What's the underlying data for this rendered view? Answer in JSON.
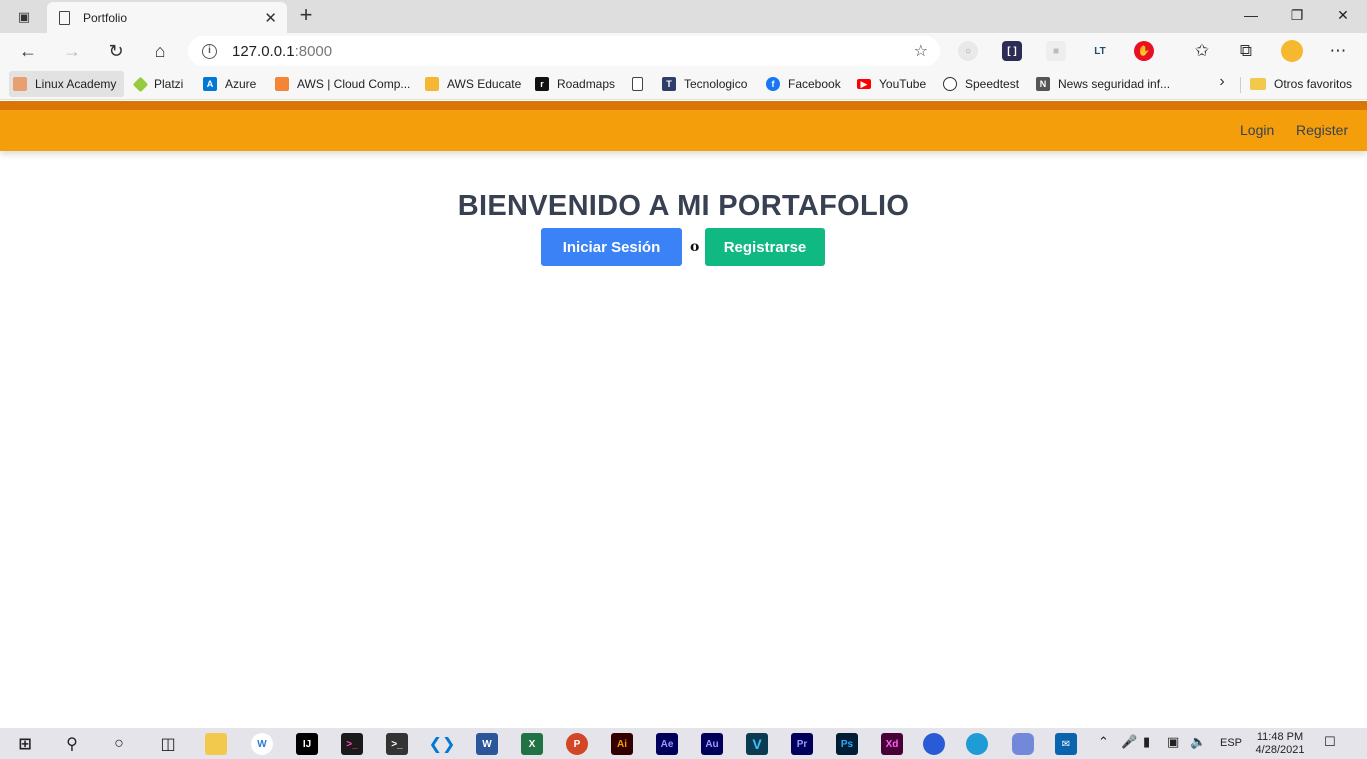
{
  "browser": {
    "tab_title": "Portfolio",
    "address_host": "127.0.0.1",
    "address_port": ":8000",
    "bookmarks": [
      {
        "label": "Linux Academy",
        "color": "#e8a070"
      },
      {
        "label": "Platzi",
        "color": "#98ca3f"
      },
      {
        "label": "Azure",
        "color": "#0078d4"
      },
      {
        "label": "AWS | Cloud Comp...",
        "color": "#f58536"
      },
      {
        "label": "AWS Educate",
        "color": "#f5b731"
      },
      {
        "label": "Roadmaps",
        "color": "#111111"
      },
      {
        "label": "",
        "color": "#ffffff"
      },
      {
        "label": "Tecnologico",
        "color": "#2f3d6b"
      },
      {
        "label": "Facebook",
        "color": "#1877f2"
      },
      {
        "label": "YouTube",
        "color": "#ff0000"
      },
      {
        "label": "Speedtest",
        "color": "#333333"
      },
      {
        "label": "News seguridad inf...",
        "color": "#555555"
      }
    ],
    "other_favorites": "Otros favoritos"
  },
  "page": {
    "nav_login": "Login",
    "nav_register": "Register",
    "heading": "BIENVENIDO A MI PORTAFOLIO",
    "login_button": "Iniciar Sesión",
    "separator": "o",
    "register_button": "Registrarse",
    "colors": {
      "navbar": "#f59e0b",
      "login_button": "#3b82f6",
      "register_button": "#10b981"
    }
  },
  "taskbar": {
    "language": "ESP",
    "time": "11:48 PM",
    "date": "4/28/2021",
    "apps": [
      {
        "name": "Word",
        "glyph": "W",
        "color": "#2b579a"
      },
      {
        "name": "Excel",
        "glyph": "X",
        "color": "#217346"
      },
      {
        "name": "PowerPoint",
        "glyph": "P",
        "color": "#d24726"
      },
      {
        "name": "Illustrator",
        "glyph": "Ai",
        "color": "#330000"
      },
      {
        "name": "After Effects",
        "glyph": "Ae",
        "color": "#00005b"
      },
      {
        "name": "Audition",
        "glyph": "Au",
        "color": "#00005b"
      },
      {
        "name": "Vegas",
        "glyph": "V",
        "color": "#0b3b50"
      },
      {
        "name": "Premiere",
        "glyph": "Pr",
        "color": "#00005b"
      },
      {
        "name": "Photoshop",
        "glyph": "Ps",
        "color": "#001e36"
      },
      {
        "name": "XD",
        "glyph": "Xd",
        "color": "#470137"
      }
    ]
  }
}
